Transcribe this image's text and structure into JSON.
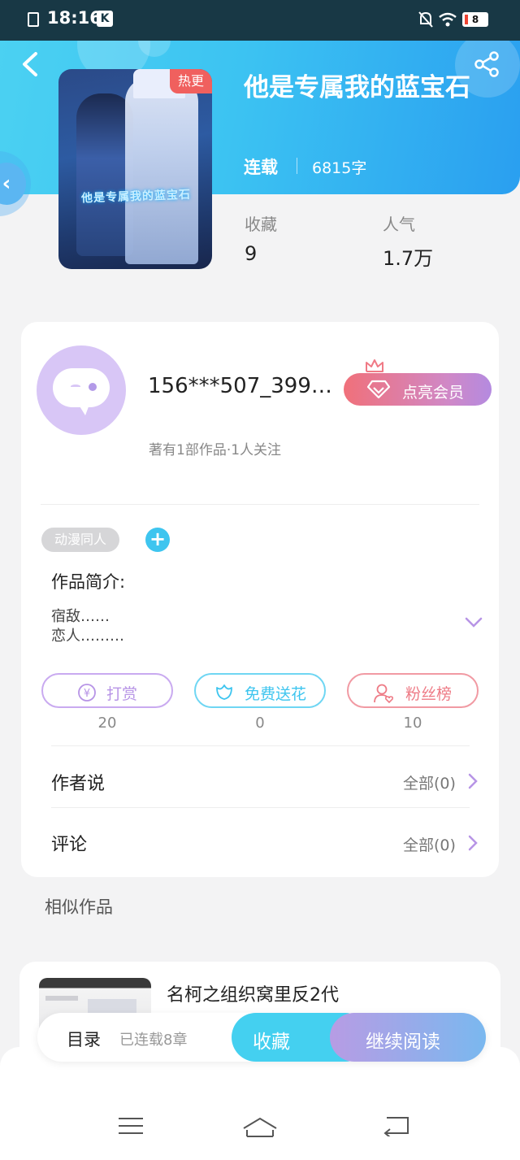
{
  "status_bar": {
    "time": "18:16",
    "k_badge": "K",
    "battery": "8"
  },
  "book": {
    "badge": "热更",
    "title": "他是专属我的蓝宝石",
    "status": "连载",
    "words": "6815字",
    "cover_text": "他是专属我的蓝宝石",
    "stats": [
      {
        "label": "收藏",
        "value": "9"
      },
      {
        "label": "人气",
        "value": "1.7万"
      }
    ]
  },
  "author": {
    "name": "156***507_399…",
    "vip_label": "点亮会员",
    "meta": "著有1部作品·1人关注"
  },
  "tags": {
    "items": [
      "动漫同人"
    ],
    "add": "+"
  },
  "intro": {
    "title": "作品简介:",
    "lines": [
      "宿敌……",
      "恋人………"
    ]
  },
  "actions": [
    {
      "label": "打赏",
      "count": "20",
      "color": "#b794e6"
    },
    {
      "label": "免费送花",
      "count": "0",
      "color": "#3ec5ef"
    },
    {
      "label": "粉丝榜",
      "count": "10",
      "color": "#ee7b86"
    }
  ],
  "rows": [
    {
      "title": "作者说",
      "all": "全部(0)"
    },
    {
      "title": "评论",
      "all": "全部(0)"
    }
  ],
  "similar": {
    "title": "相似作品",
    "items": [
      {
        "name": "名柯之组织窝里反2代"
      }
    ]
  },
  "bottom_bar": {
    "toc": "目录",
    "chapters": "已连载8章",
    "favorite": "收藏",
    "continue": "继续阅读"
  },
  "colors": {
    "accent": "#3ec5ef",
    "purple": "#b794e6",
    "pink": "#ee7b86"
  }
}
